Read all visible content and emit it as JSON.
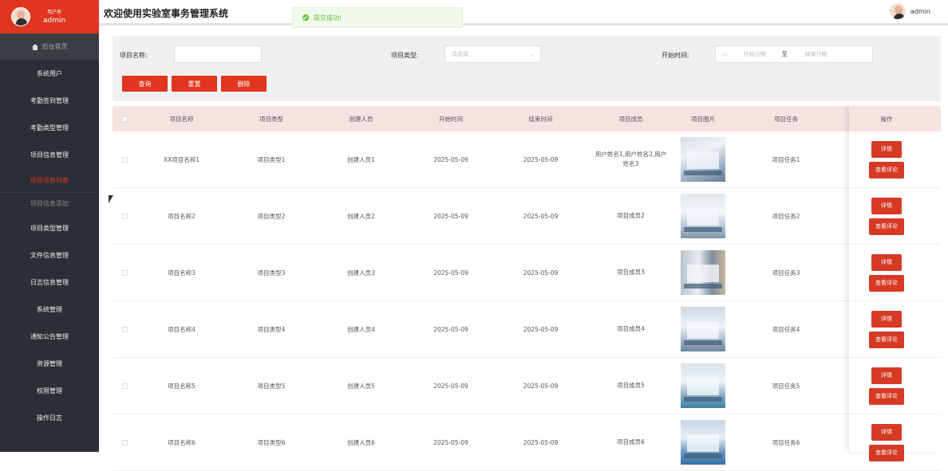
{
  "sidebar": {
    "user_role": "用户名",
    "user_name": "admin",
    "items": [
      {
        "label": "后台首页"
      },
      {
        "label": "系统用户"
      },
      {
        "label": "考勤签到管理"
      },
      {
        "label": "考勤类型管理"
      },
      {
        "label": "项目信息管理"
      },
      {
        "label": "项目信息列表"
      },
      {
        "label": "项目信息添加"
      },
      {
        "label": "项目类型管理"
      },
      {
        "label": "文件信息管理"
      },
      {
        "label": "日志信息管理"
      },
      {
        "label": "系统管理"
      },
      {
        "label": "通知公告管理"
      },
      {
        "label": "资源管理"
      },
      {
        "label": "权限管理"
      },
      {
        "label": "操作日志"
      }
    ]
  },
  "header": {
    "title": "欢迎使用实验室事务管理系统",
    "user": "admin"
  },
  "toast": {
    "message": "提交成功!"
  },
  "filter": {
    "name_label": "项目名称:",
    "type_label": "项目类型:",
    "type_placeholder": "请选择",
    "time_label": "开始时间:",
    "start_placeholder": "开始日期",
    "range_sep": "至",
    "end_placeholder": "结束日期",
    "search_btn": "查询",
    "reset_btn": "重置",
    "delete_btn": "删除"
  },
  "table": {
    "headers": [
      "项目名称",
      "项目类型",
      "创建人员",
      "开始时间",
      "结束时间",
      "项目成员",
      "项目图片",
      "项目任务",
      "操作"
    ],
    "detail_btn": "详情",
    "review_btn": "查看评论",
    "rows": [
      {
        "name": "XX项目名称1",
        "type": "项目类型1",
        "creator": "创建人员1",
        "start": "2025-05-09",
        "end": "2025-05-09",
        "members": "用户姓名1,用户姓名2,用户姓名3",
        "task": "项目任务1"
      },
      {
        "name": "项目名称2",
        "type": "项目类型2",
        "creator": "创建人员2",
        "start": "2025-05-09",
        "end": "2025-05-09",
        "members": "项目成员2",
        "task": "项目任务2"
      },
      {
        "name": "项目名称3",
        "type": "项目类型3",
        "creator": "创建人员3",
        "start": "2025-05-09",
        "end": "2025-05-09",
        "members": "项目成员3",
        "task": "项目任务3"
      },
      {
        "name": "项目名称4",
        "type": "项目类型4",
        "creator": "创建人员4",
        "start": "2025-05-09",
        "end": "2025-05-09",
        "members": "项目成员4",
        "task": "项目任务4"
      },
      {
        "name": "项目名称5",
        "type": "项目类型5",
        "creator": "创建人员5",
        "start": "2025-05-09",
        "end": "2025-05-09",
        "members": "项目成员5",
        "task": "项目任务5"
      },
      {
        "name": "项目名称6",
        "type": "项目类型6",
        "creator": "创建人员6",
        "start": "2025-05-09",
        "end": "2025-05-09",
        "members": "项目成员6",
        "task": "项目任务6"
      }
    ]
  },
  "colors": {
    "accent": "#e0351f",
    "sidebar": "#2b2e35",
    "header_row": "#f7e2e2"
  }
}
